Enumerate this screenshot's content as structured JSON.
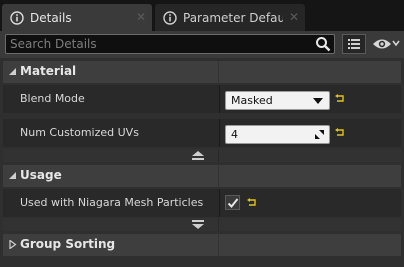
{
  "tabs": [
    {
      "label": "Details",
      "active": true
    },
    {
      "label": "Parameter Defaults",
      "active": false
    }
  ],
  "search": {
    "placeholder": "Search Details"
  },
  "categories": {
    "material": {
      "label": "Material",
      "blend_mode": {
        "label": "Blend Mode",
        "value": "Masked"
      },
      "num_uvs": {
        "label": "Num Customized UVs",
        "value": "4"
      }
    },
    "usage": {
      "label": "Usage",
      "niagara": {
        "label": "Used with Niagara Mesh Particles",
        "checked": true
      }
    },
    "group_sorting": {
      "label": "Group Sorting"
    }
  },
  "colors": {
    "reset_arrow": "#e3c31a",
    "input_bg": "#f2f2f2",
    "panel_bg": "#2f2f2f"
  }
}
